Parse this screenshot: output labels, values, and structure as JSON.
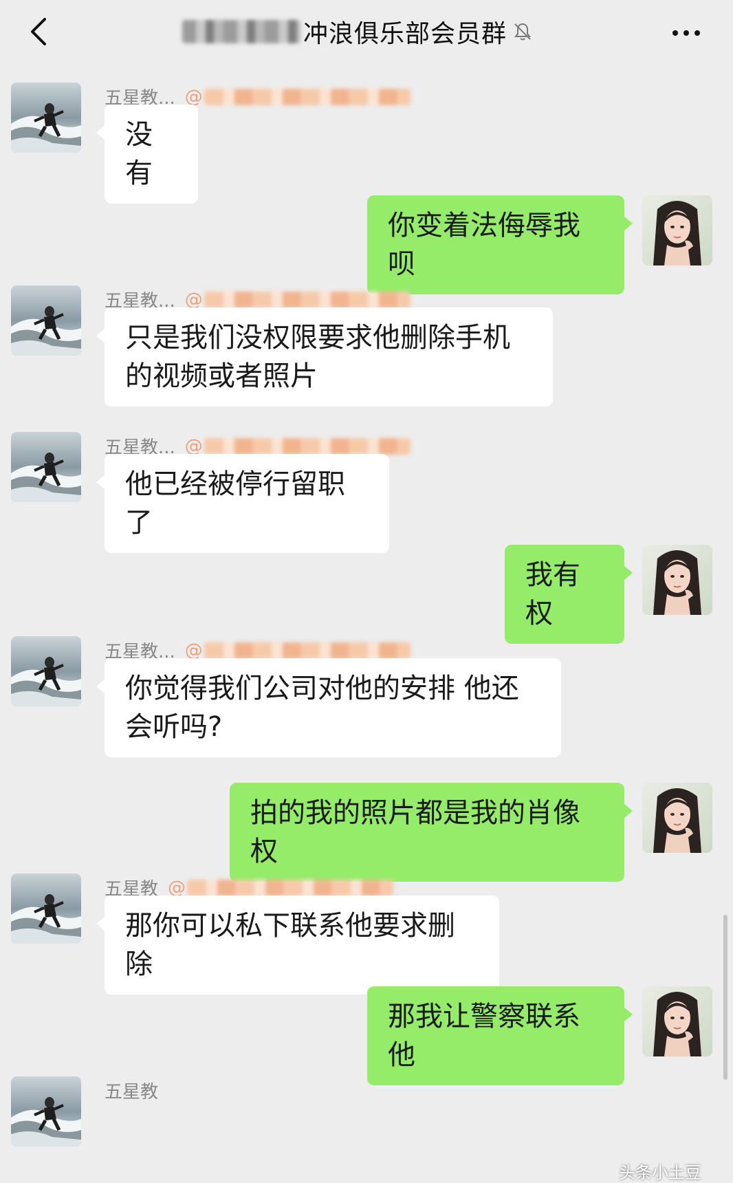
{
  "header": {
    "title": "冲浪俱乐部会员群",
    "back_icon": "chevron-left-icon",
    "mute_icon": "bell-muted-icon",
    "more_icon": "more-horizontal-icon"
  },
  "messages": [
    {
      "side": "in",
      "sender": "五星教...",
      "mention": "@",
      "text": "没有"
    },
    {
      "side": "out",
      "text": "你变着法侮辱我呗"
    },
    {
      "side": "in",
      "sender": "五星教...",
      "mention": "@",
      "text": "只是我们没权限要求他删除手机的视频或者照片"
    },
    {
      "side": "in",
      "sender": "五星教...",
      "mention": "@",
      "text": "他已经被停行留职了"
    },
    {
      "side": "out",
      "text": "我有权"
    },
    {
      "side": "in",
      "sender": "五星教...",
      "mention": "@",
      "text": "你觉得我们公司对他的安排 他还会听吗?"
    },
    {
      "side": "out",
      "text": "拍的我的照片都是我的肖像权"
    },
    {
      "side": "in",
      "sender": "五星教",
      "mention": "@",
      "text": "那你可以私下联系他要求删除"
    },
    {
      "side": "out",
      "text": "那我让警察联系他"
    },
    {
      "side": "in",
      "sender": "五星教",
      "mention": "",
      "text": ""
    }
  ],
  "watermark": "头条小土豆",
  "colors": {
    "background": "#ededed",
    "incoming_bubble": "#ffffff",
    "outgoing_bubble": "#95ec69"
  }
}
